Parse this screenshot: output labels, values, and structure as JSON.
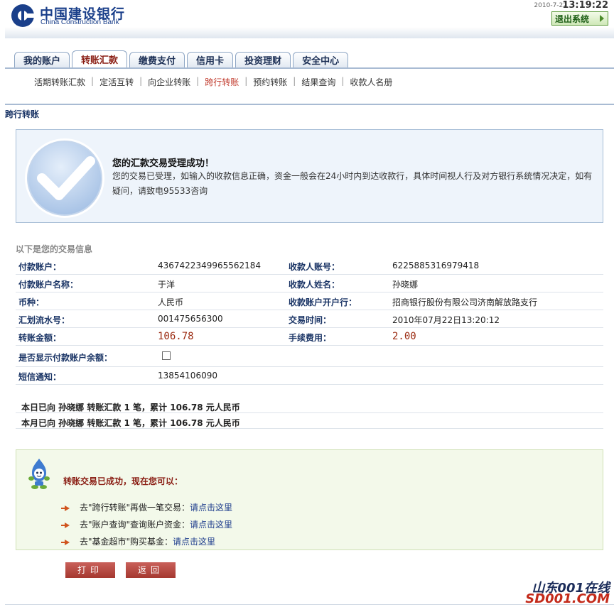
{
  "header": {
    "bank_name_cn": "中国建设银行",
    "bank_name_en": "China Construction Bank",
    "date": "2010-7-22",
    "time": "13:19:22",
    "logout_label": "退出系统"
  },
  "tabs": [
    {
      "label": "我的账户",
      "active": false
    },
    {
      "label": "转账汇款",
      "active": true
    },
    {
      "label": "缴费支付",
      "active": false
    },
    {
      "label": "信用卡",
      "active": false
    },
    {
      "label": "投资理财",
      "active": false
    },
    {
      "label": "安全中心",
      "active": false
    }
  ],
  "subnav": [
    {
      "label": "活期转账汇款",
      "active": false
    },
    {
      "label": "定活互转",
      "active": false
    },
    {
      "label": "向企业转账",
      "active": false
    },
    {
      "label": "跨行转账",
      "active": true
    },
    {
      "label": "预约转账",
      "active": false
    },
    {
      "label": "结果查询",
      "active": false
    },
    {
      "label": "收款人名册",
      "active": false
    }
  ],
  "section_title": "跨行转账",
  "success": {
    "title": "您的汇款交易受理成功！",
    "message": "您的交易已受理，如输入的收款信息正确，资金一般会在24小时内到达收款行，具体时间视人行及对方银行系统情况决定，如有疑问，请致电95533咨询"
  },
  "info": {
    "header": "以下是您的交易信息",
    "rows": [
      {
        "l1": "付款账户：",
        "v1": "4367422349965562184",
        "l2": "收款人账号：",
        "v2": "6225885316979418"
      },
      {
        "l1": "付款账户名称：",
        "v1": "于洋",
        "l2": "收款人姓名：",
        "v2": "孙晓娜"
      },
      {
        "l1": "币种：",
        "v1": "人民币",
        "l2": "收款账户开户行：",
        "v2": "招商银行股份有限公司济南解放路支行"
      },
      {
        "l1": "汇划流水号：",
        "v1": "001475656300",
        "l2": "交易时间：",
        "v2": "2010年07月22日13:20:12"
      },
      {
        "l1": "转账金额：",
        "v1": "106.78",
        "l2": "手续费用：",
        "v2": "2.00"
      }
    ],
    "show_balance_label": "是否显示付款账户余额：",
    "show_balance_checked": false,
    "sms_label": "短信通知：",
    "sms_value": "13854106090"
  },
  "summary": {
    "daily": "本日已向 孙晓娜 转账汇款 1 笔，累计 106.78 元人民币",
    "monthly": "本月已向 孙晓娜 转账汇款 1 笔，累计 106.78 元人民币"
  },
  "next_steps": {
    "title": "转账交易已成功，现在您可以：",
    "items": [
      {
        "prefix": "去\"跨行转账\"再做一笔交易：",
        "link": "请点击这里"
      },
      {
        "prefix": "去\"账户查询\"查询账户资金：",
        "link": "请点击这里"
      },
      {
        "prefix": "去\"基金超市\"购买基金：",
        "link": "请点击这里"
      }
    ]
  },
  "buttons": {
    "print": "打印",
    "back": "返回"
  },
  "watermark": {
    "line1": "山东001在线",
    "line2": "SD001.COM"
  },
  "colors": {
    "brand_blue": "#1a3f8a",
    "active_tab": "#8a1e14",
    "amount_red": "#9b2a10",
    "button_red": "#a5382f"
  }
}
